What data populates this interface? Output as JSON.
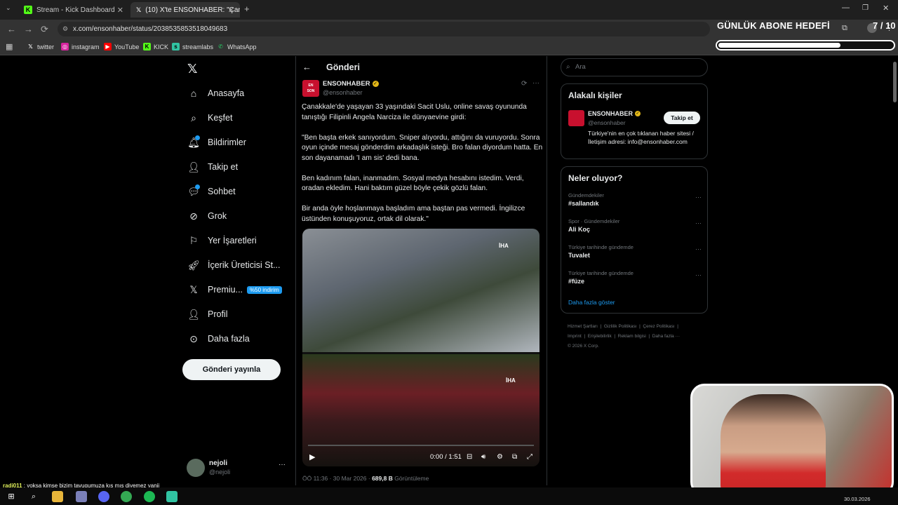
{
  "browser": {
    "tabs": [
      {
        "title": "Stream - Kick Dashboard",
        "favicon": "kick-icon",
        "active": false
      },
      {
        "title": "(10) X'te ENSONHABER: \"Çanak",
        "favicon": "x-logo-icon",
        "active": true
      }
    ],
    "url": "x.com/ensonhaber/status/2038535853518049683",
    "bookmarks": [
      "twitter",
      "instagram",
      "YouTube",
      "KICK",
      "streamlabs",
      "WhatsApp"
    ]
  },
  "overlay": {
    "goal_title": "GÜNLÜK ABONE HEDEFİ",
    "goal_count": "7 / 10",
    "goal_progress": 0.7
  },
  "sidebar": {
    "items": [
      {
        "label": "Anasayfa",
        "icon": "home-icon"
      },
      {
        "label": "Keşfet",
        "icon": "search-icon"
      },
      {
        "label": "Bildirimler",
        "icon": "bell-icon"
      },
      {
        "label": "Takip et",
        "icon": "follow-icon"
      },
      {
        "label": "Sohbet",
        "icon": "chat-icon"
      },
      {
        "label": "Grok",
        "icon": "grok-icon"
      },
      {
        "label": "Yer İşaretleri",
        "icon": "bookmark-icon"
      },
      {
        "label": "İçerik Üreticisi St...",
        "icon": "rocket-icon"
      },
      {
        "label": "Premiu...",
        "icon": "x-premium-icon"
      },
      {
        "label": "Profil",
        "icon": "profile-icon"
      },
      {
        "label": "Daha fazla",
        "icon": "more-circle-icon"
      }
    ],
    "premium_badge": "%50 indirim",
    "post_button": "Gönderi yayınla",
    "profile": {
      "name": "nejoli",
      "handle": "@nejoli"
    }
  },
  "main": {
    "header": "Gönderi",
    "author": {
      "name": "ENSONHABER",
      "handle": "@ensonhaber"
    },
    "paragraphs": [
      "Çanakkale'de yaşayan 33 yaşındaki Sacit Uslu, online savaş oyununda tanıştığı Filipinli Angela Narciza ile dünyaevine girdi:",
      "\"Ben başta erkek sanıyordum. Sniper alıyordu, attığını da vuruyordu. Sonra oyun içinde mesaj gönderdim arkadaşlık isteği. Bro falan diyordum hatta. En son dayanamadı 'I am sis' dedi bana.",
      "Ben kadınım falan, inanmadım. Sosyal medya hesabını istedim. Verdi, oradan ekledim. Hani baktım güzel böyle çekik gözlü falan.",
      "Bir anda öyle hoşlanmaya başladım ama baştan pas vermedi. İngilizce üstünden konuşuyoruz, ortak dil olarak.\""
    ],
    "media_watermark": "İHA",
    "video_time": "0:00 / 1:51",
    "meta": {
      "time": "ÖÖ 11:36 · 30 Mar 2026 · ",
      "views": "689,8 B",
      "views_label": " Görüntüleme"
    }
  },
  "right": {
    "search_placeholder": "Ara",
    "related_title": "Alakalı kişiler",
    "related": {
      "name": "ENSONHABER",
      "handle": "@ensonhaber",
      "follow": "Takip et",
      "bio": "Türkiye'nin en çok tıklanan haber sitesi / İletişim adresi: info@ensonhaber.com"
    },
    "trends_title": "Neler oluyor?",
    "trends": [
      {
        "context": "Gündemdekiler",
        "name": "#sallandık"
      },
      {
        "context": "Spor · Gündemdekiler",
        "name": "Ali Koç"
      },
      {
        "context": "Türkiye tarihinde gündemde",
        "name": "Tuvalet"
      },
      {
        "context": "Türkiye tarihinde gündemde",
        "name": "#füze"
      }
    ],
    "show_more": "Daha fazla göster",
    "footer": [
      "Hizmet Şartları",
      "Gizlilik Politikası",
      "Çerez Politikası",
      "Imprint",
      "Erişilebilirlik",
      "Reklam bilgisi",
      "Daha fazla ···",
      "© 2026 X Corp."
    ]
  },
  "chat": {
    "user": "radi011",
    "message": " : yoksa kimse bizim tavugumuza kış mış diyemez yanii"
  },
  "taskbar": {
    "date": "30.03.2026"
  },
  "colors": {
    "accent": "#1d9bf0",
    "background": "#000000",
    "text": "#e7e9ea",
    "muted": "#71767b"
  }
}
